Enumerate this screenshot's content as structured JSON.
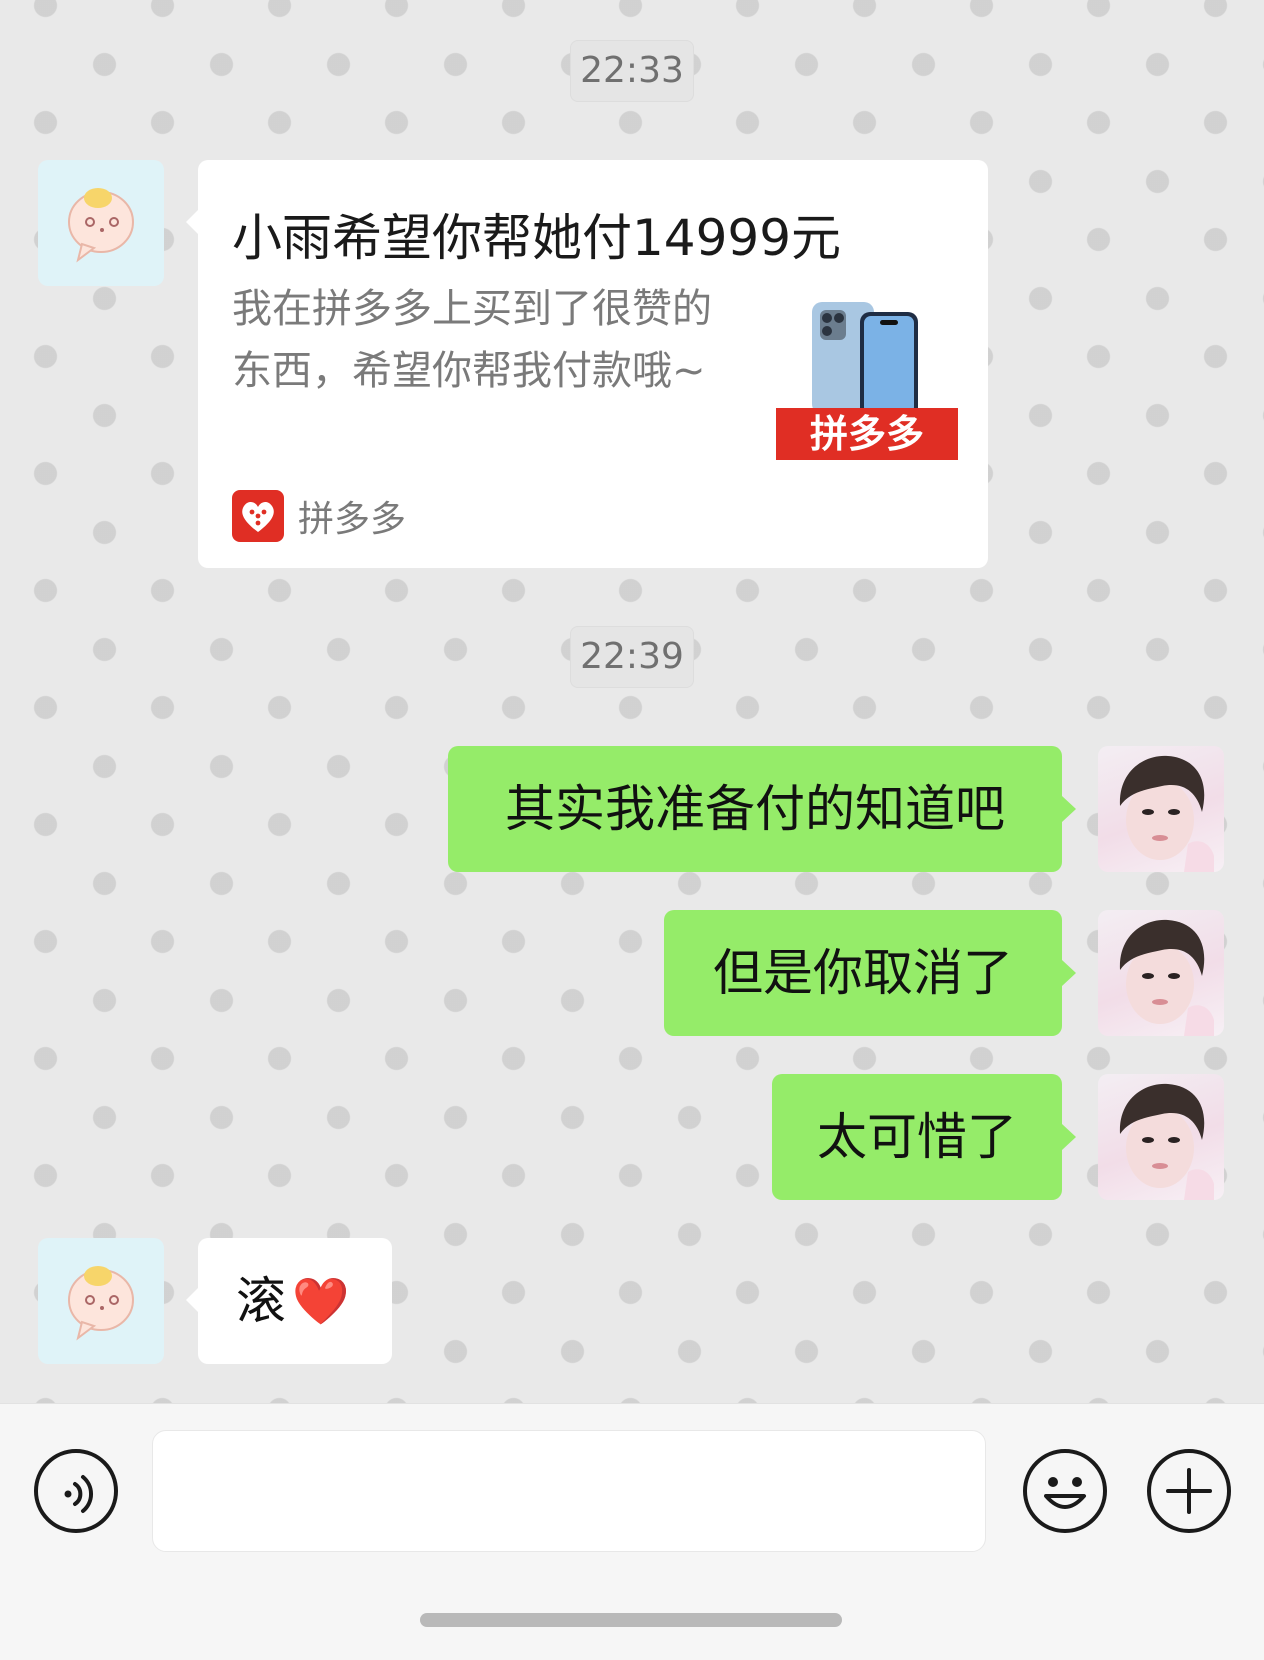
{
  "chat": {
    "timestamps": [
      "22:33",
      "22:39"
    ],
    "payment_card": {
      "title": "小雨希望你帮她付14999元",
      "description": "我在拼多多上买到了很赞的东西，希望你帮我付款哦~",
      "thumbnail_badge": "拼多多",
      "source_app": "拼多多",
      "source_icon": "pinduoduo-heart-icon"
    },
    "sent_messages": [
      "其实我准备付的知道吧",
      "但是你取消了",
      "太可惜了"
    ],
    "received_reply": {
      "text": "滚",
      "emoji": "❤️"
    }
  },
  "input_bar": {
    "voice_icon": "voice-icon",
    "emoji_icon": "emoji-face-icon",
    "plus_icon": "plus-icon",
    "input_value": ""
  },
  "colors": {
    "sent_bubble": "#95ec69",
    "received_bubble": "#ffffff",
    "chat_background": "#e9e9e9",
    "pdd_red": "#e02e24"
  }
}
